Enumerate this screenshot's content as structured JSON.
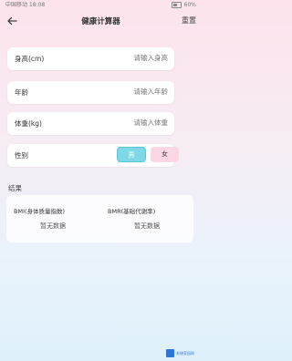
{
  "status_bar": {
    "left_text": "中国移动 18:08",
    "battery": "60%"
  },
  "nav": {
    "back_icon": "arrow-left-icon",
    "title": "健康计算器",
    "reset_label": "重置"
  },
  "fields": [
    {
      "label": "身高(cm)",
      "placeholder": "请输入身高"
    },
    {
      "label": "年龄",
      "placeholder": "请输入年龄"
    },
    {
      "label": "体重(kg)",
      "placeholder": "请输入体重"
    }
  ],
  "gender": {
    "label": "性别",
    "male": "男",
    "female": "女",
    "selected": "男"
  },
  "results": {
    "title": "结果",
    "bmi": {
      "name": "BMI(身体质量指数)",
      "value": "暂无数据"
    },
    "bmr": {
      "name": "BMR(基础代谢率)",
      "value": "暂无数据"
    }
  },
  "watermark": {
    "text": "系统家园网"
  },
  "colors": {
    "male_active": "#7ed8e6",
    "female_bg": "#fbd6e4",
    "bg_top": "#fde3ec",
    "bg_bottom": "#dff0fb"
  }
}
